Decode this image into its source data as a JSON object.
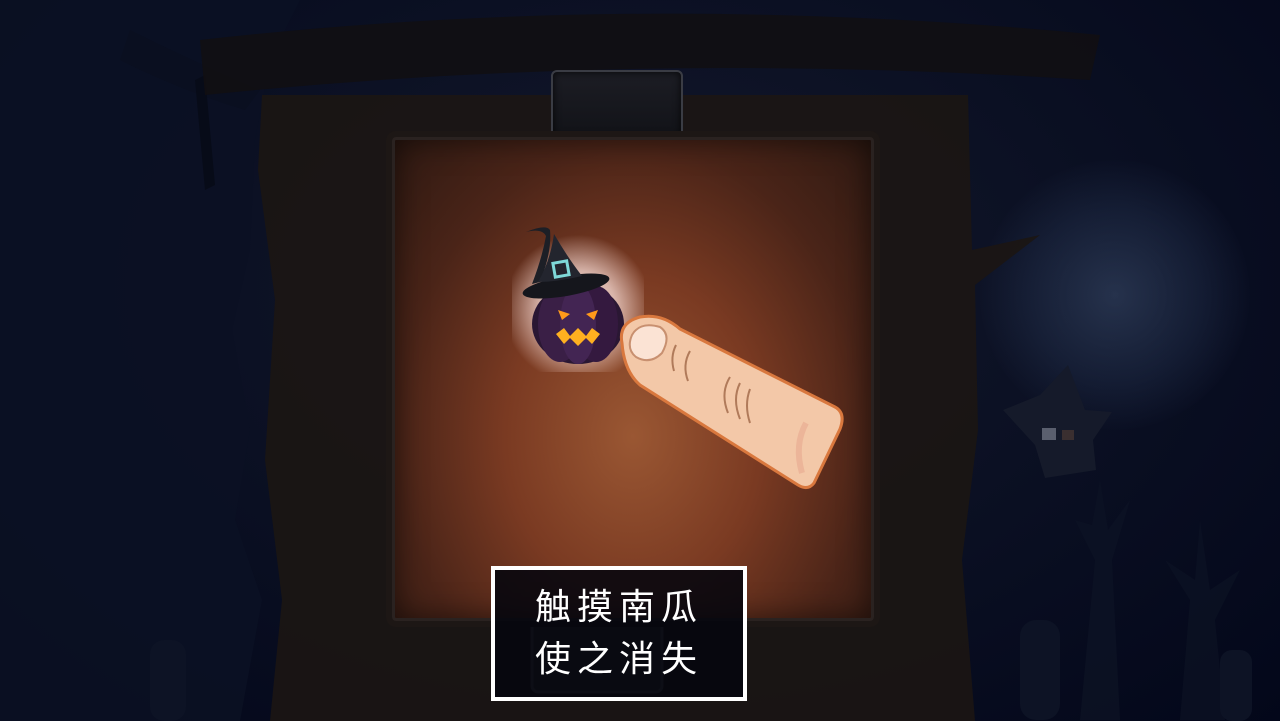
{
  "scene": {
    "background": "#04081a",
    "panel_accent": "#9a5733",
    "moon_color": "#3c4e6e"
  },
  "tutorial": {
    "line1": "触摸南瓜",
    "line2": "使之消失"
  },
  "icons": {
    "target": "pumpkin-witch-hat-icon",
    "pointer": "finger-pointer-icon"
  }
}
